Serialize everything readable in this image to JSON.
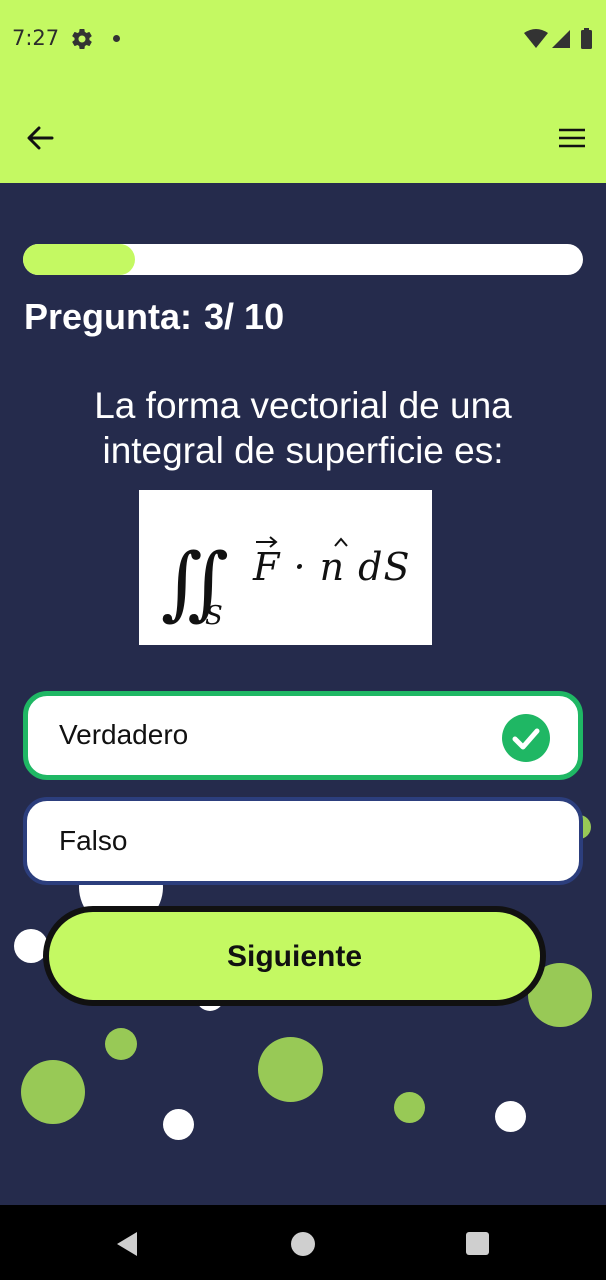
{
  "status_bar": {
    "time": "7:27",
    "icons": [
      "settings-gear-icon",
      "notification-dot-icon",
      "wifi-icon",
      "cellular-signal-icon",
      "battery-icon"
    ]
  },
  "app_bar": {
    "background": "#c4f962",
    "back_icon": "arrow-left-icon",
    "menu_icon": "hamburger-menu-icon"
  },
  "quiz": {
    "progress_fraction": 0.2,
    "question_label": "Pregunta:",
    "question_number": "3/ 10",
    "question_text": "La forma vectorial de una integral de superficie es:",
    "formula": {
      "integral_sign": "∬",
      "subscript": "S",
      "body": "F · n dS"
    },
    "options": [
      {
        "label": "Verdadero",
        "state": "correct",
        "icon": "check-circle-icon"
      },
      {
        "label": "Falso",
        "state": "unselected"
      }
    ],
    "next_button_label": "Siguiente"
  },
  "colors": {
    "accent": "#c4f962",
    "background": "#252b4c",
    "correct_border": "#1fb764",
    "option_border": "#2c3e7d",
    "bubble_green": "#98c956"
  },
  "nav_bar": {
    "icons": [
      "nav-back-icon",
      "nav-home-icon",
      "nav-recents-icon"
    ]
  }
}
